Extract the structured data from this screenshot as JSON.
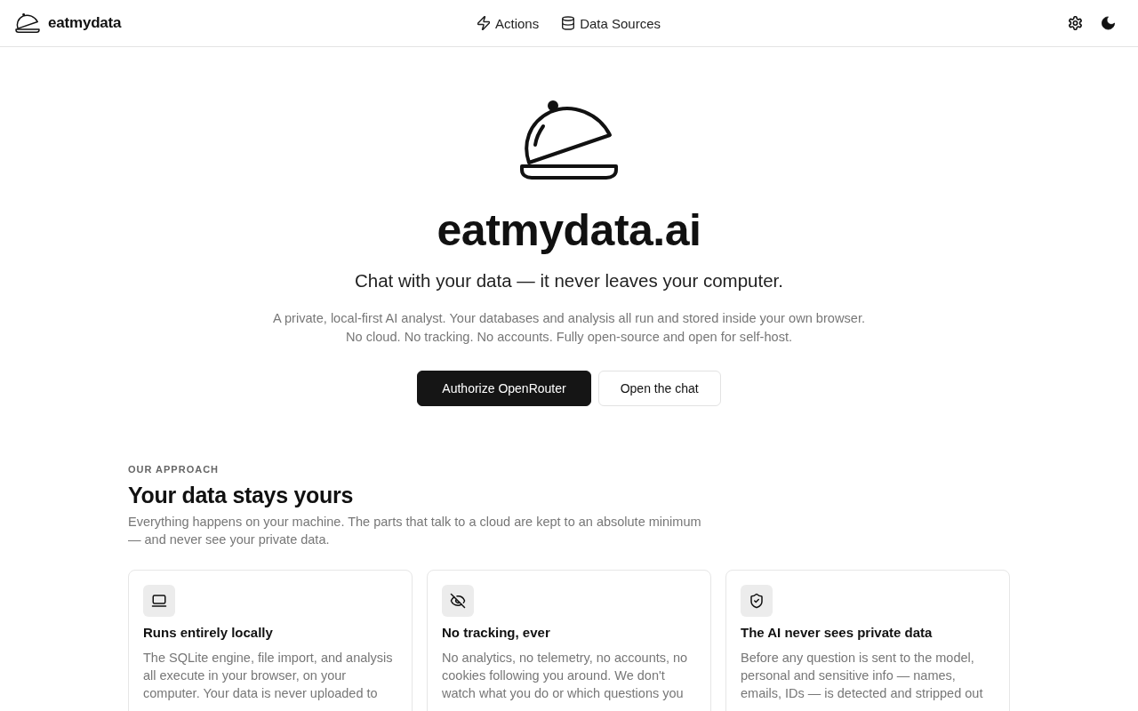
{
  "header": {
    "brand": "eatmydata",
    "nav": [
      {
        "label": "Actions"
      },
      {
        "label": "Data Sources"
      }
    ]
  },
  "hero": {
    "title": "eatmydata.ai",
    "subtitle": "Chat with your data — it never leaves your computer.",
    "description": [
      "A private, local-first AI analyst. Your databases and analysis all run and stored inside your own browser.",
      "No cloud. No tracking. No accounts. Fully open-source and open for self-host."
    ],
    "buttons": [
      {
        "label": "Authorize OpenRouter",
        "kind": "primary"
      },
      {
        "label": "Open the chat",
        "kind": "secondary"
      }
    ]
  },
  "approach": {
    "eyebrow": "OUR APPROACH",
    "heading": "Your data stays yours",
    "intro": "Everything happens on your machine. The parts that talk to a cloud are kept to an absolute minimum — and never see your private data.",
    "cards": [
      {
        "title": "Runs entirely locally",
        "body": "The SQLite engine, file import, and analysis all execute in your browser, on your computer. Your data is never uploaded to"
      },
      {
        "title": "No tracking, ever",
        "body": "No analytics, no telemetry, no accounts, no cookies following you around. We don't watch what you do or which questions you"
      },
      {
        "title": "The AI never sees private data",
        "body": "Before any question is sent to the model, personal and sensitive info — names, emails, IDs — is detected and stripped out"
      }
    ]
  }
}
